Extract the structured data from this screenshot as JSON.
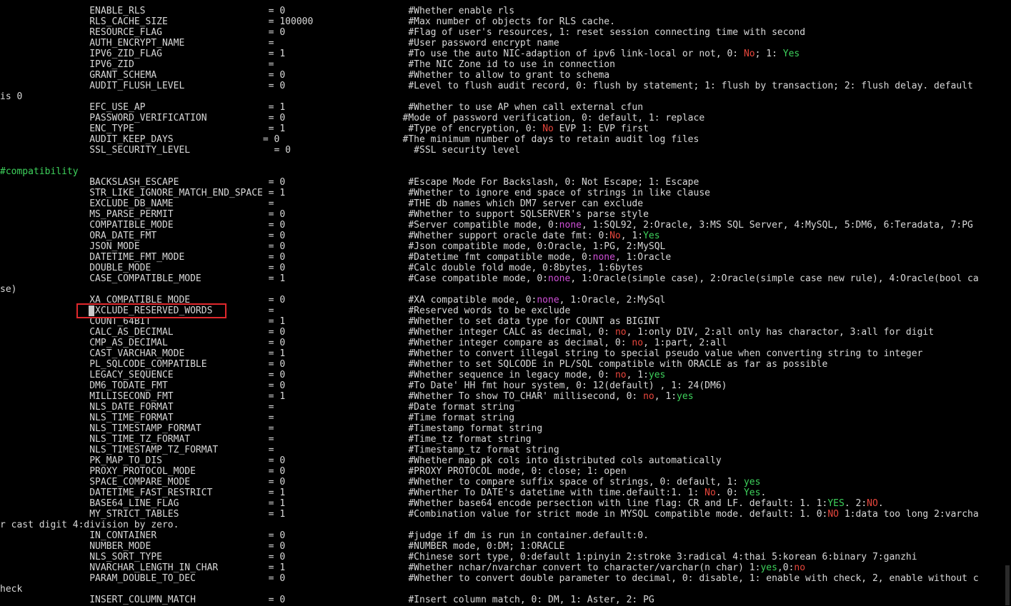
{
  "terminal": {
    "lines": [
      {
        "segs": [
          {
            "t": "                ENABLE_RLS                      = 0                      #Whether enable rls"
          }
        ]
      },
      {
        "segs": [
          {
            "t": "                RLS_CACHE_SIZE                  = 100000                 #Max number of objects for RLS cache."
          }
        ]
      },
      {
        "segs": [
          {
            "t": "                RESOURCE_FLAG                   = 0                      #Flag of user's resources, 1: reset session connecting time with second"
          }
        ]
      },
      {
        "segs": [
          {
            "t": "                AUTH_ENCRYPT_NAME               =                        #User password encrypt name"
          }
        ]
      },
      {
        "segs": [
          {
            "t": "                IPV6_ZID_FLAG                   = 1                      #To use the auto NIC-adaption of ipv6 link-local or not, 0: "
          },
          {
            "t": "No",
            "c": "c-red"
          },
          {
            "t": "; 1: "
          },
          {
            "t": "Yes",
            "c": "c-green"
          }
        ]
      },
      {
        "segs": [
          {
            "t": "                IPV6_ZID                        =                        #The NIC Zone id to use in connection"
          }
        ]
      },
      {
        "segs": [
          {
            "t": "                GRANT_SCHEMA                    = 0                      #Whether to allow to grant to schema"
          }
        ]
      },
      {
        "segs": [
          {
            "t": "                AUDIT_FLUSH_LEVEL               = 0                      #Level to flush audit record, 0: flush by statement; 1: flush by transaction; 2: flush delay. default"
          }
        ]
      },
      {
        "segs": [
          {
            "t": "is 0"
          }
        ]
      },
      {
        "segs": [
          {
            "t": "                EFC_USE_AP                      = 1                      #Whether to use AP when call external cfun"
          }
        ]
      },
      {
        "segs": [
          {
            "t": "                PASSWORD_VERIFICATION           = 0                     #Mode of password verification, 0: default, 1: replace"
          }
        ]
      },
      {
        "segs": [
          {
            "t": "                ENC_TYPE                        = 1                      #Type of encryption, 0: "
          },
          {
            "t": "No",
            "c": "c-red"
          },
          {
            "t": " EVP 1: EVP first"
          }
        ]
      },
      {
        "segs": [
          {
            "t": "                AUDIT_KEEP_DAYS                = 0                      #The minimum number of days to retain audit log files"
          }
        ]
      },
      {
        "segs": [
          {
            "t": "                SSL_SECURITY_LEVEL               = 0                      #SSL security level"
          }
        ]
      },
      {
        "segs": [
          {
            "t": ""
          }
        ]
      },
      {
        "segs": [
          {
            "t": "#compatibility",
            "c": "c-cyan"
          }
        ]
      },
      {
        "segs": [
          {
            "t": "                BACKSLASH_ESCAPE                = 0                      #Escape Mode For Backslash, 0: Not Escape; 1: Escape"
          }
        ]
      },
      {
        "segs": [
          {
            "t": "                STR_LIKE_IGNORE_MATCH_END_SPACE = 1                      #Whether to ignore end space of strings in like clause"
          }
        ]
      },
      {
        "segs": [
          {
            "t": "                EXCLUDE_DB_NAME                 =                        #THE db names which DM7 server can exclude"
          }
        ]
      },
      {
        "segs": [
          {
            "t": "                MS_PARSE_PERMIT                 = 0                      #Whether to support SQLSERVER's parse style"
          }
        ]
      },
      {
        "segs": [
          {
            "t": "                COMPATIBLE_MODE                 = 0                      #Server compatible mode, 0:"
          },
          {
            "t": "none",
            "c": "c-mag"
          },
          {
            "t": ", 1:SQL92, 2:Oracle, 3:MS SQL Server, 4:MySQL, 5:DM6, 6:Teradata, 7:PG"
          }
        ]
      },
      {
        "segs": [
          {
            "t": "                ORA_DATE_FMT                    = 0                      #Whether support oracle date fmt: 0:"
          },
          {
            "t": "No",
            "c": "c-red"
          },
          {
            "t": ", 1:"
          },
          {
            "t": "Yes",
            "c": "c-green"
          }
        ]
      },
      {
        "segs": [
          {
            "t": "                JSON_MODE                       = 0                      #Json compatible mode, 0:Oracle, 1:PG, 2:MySQL"
          }
        ]
      },
      {
        "segs": [
          {
            "t": "                DATETIME_FMT_MODE               = 0                      #Datetime fmt compatible mode, 0:"
          },
          {
            "t": "none",
            "c": "c-mag"
          },
          {
            "t": ", 1:Oracle"
          }
        ]
      },
      {
        "segs": [
          {
            "t": "                DOUBLE_MODE                     = 0                      #Calc double fold mode, 0:8bytes, 1:6bytes"
          }
        ]
      },
      {
        "segs": [
          {
            "t": "                CASE_COMPATIBLE_MODE            = 1                      #Case compatible mode, 0:"
          },
          {
            "t": "none",
            "c": "c-mag"
          },
          {
            "t": ", 1:Oracle(simple case), 2:Oracle(simple case new rule), 4:Oracle(bool ca"
          }
        ]
      },
      {
        "segs": [
          {
            "t": "se)"
          }
        ]
      },
      {
        "segs": [
          {
            "t": "                XA_COMPATIBLE_MODE              = 0                      #XA compatible mode, 0:"
          },
          {
            "t": "none",
            "c": "c-mag"
          },
          {
            "t": ", 1:Oracle, 2:MySql"
          }
        ]
      },
      {
        "segs": [
          {
            "t": "                EXCLUDE_RESERVED_WORDS          =                        #Reserved words to be exclude"
          }
        ]
      },
      {
        "segs": [
          {
            "t": "                COUNT_64BIT                     = 1                      #Whether to set data type for COUNT as BIGINT"
          }
        ]
      },
      {
        "segs": [
          {
            "t": "                CALC_AS_DECIMAL                 = 0                      #Whether integer CALC as decimal, 0: "
          },
          {
            "t": "no",
            "c": "c-red"
          },
          {
            "t": ", 1:only DIV, 2:all only has charactor, 3:all for digit"
          }
        ]
      },
      {
        "segs": [
          {
            "t": "                CMP_AS_DECIMAL                  = 0                      #Whether integer compare as decimal, 0: "
          },
          {
            "t": "no",
            "c": "c-red"
          },
          {
            "t": ", 1:part, 2:all"
          }
        ]
      },
      {
        "segs": [
          {
            "t": "                CAST_VARCHAR_MODE               = 1                      #Whether to convert illegal string to special pseudo value when converting string to integer"
          }
        ]
      },
      {
        "segs": [
          {
            "t": "                PL_SQLCODE_COMPATIBLE           = 0                      #Whether to set SQLCODE in PL/SQL compatible with ORACLE as far as possible"
          }
        ]
      },
      {
        "segs": [
          {
            "t": "                LEGACY_SEQUENCE                 = 0                      #Whether sequence in legacy mode, 0: "
          },
          {
            "t": "no",
            "c": "c-red"
          },
          {
            "t": ", 1:"
          },
          {
            "t": "yes",
            "c": "c-green"
          }
        ]
      },
      {
        "segs": [
          {
            "t": "                DM6_TODATE_FMT                  = 0                      #To Date' HH fmt hour system, 0: 12(default) , 1: 24(DM6)"
          }
        ]
      },
      {
        "segs": [
          {
            "t": "                MILLISECOND_FMT                 = 1                      #Whether To show TO_CHAR' millisecond, 0: "
          },
          {
            "t": "no",
            "c": "c-red"
          },
          {
            "t": ", 1:"
          },
          {
            "t": "yes",
            "c": "c-green"
          }
        ]
      },
      {
        "segs": [
          {
            "t": "                NLS_DATE_FORMAT                 =                        #Date format string"
          }
        ]
      },
      {
        "segs": [
          {
            "t": "                NLS_TIME_FORMAT                 =                        #Time format string"
          }
        ]
      },
      {
        "segs": [
          {
            "t": "                NLS_TIMESTAMP_FORMAT            =                        #Timestamp format string"
          }
        ]
      },
      {
        "segs": [
          {
            "t": "                NLS_TIME_TZ_FORMAT              =                        #Time_tz format string"
          }
        ]
      },
      {
        "segs": [
          {
            "t": "                NLS_TIMESTAMP_TZ_FORMAT         =                        #Timestamp_tz format string"
          }
        ]
      },
      {
        "segs": [
          {
            "t": "                PK_MAP_TO_DIS                   = 0                      #Whether map pk cols into distributed cols automatically"
          }
        ]
      },
      {
        "segs": [
          {
            "t": "                PROXY_PROTOCOL_MODE             = 0                      #PROXY PROTOCOL mode, 0: close; 1: open"
          }
        ]
      },
      {
        "segs": [
          {
            "t": "                SPACE_COMPARE_MODE              = 0                      #Whether to compare suffix space of strings, 0: default, 1: "
          },
          {
            "t": "yes",
            "c": "c-green"
          }
        ]
      },
      {
        "segs": [
          {
            "t": "                DATETIME_FAST_RESTRICT          = 1                      #Wherther To DATE's datetime with time.default:1. 1: "
          },
          {
            "t": "No",
            "c": "c-red"
          },
          {
            "t": ". 0: "
          },
          {
            "t": "Yes",
            "c": "c-green"
          },
          {
            "t": "."
          }
        ]
      },
      {
        "segs": [
          {
            "t": "                BASE64_LINE_FLAG                = 1                      #Whether base64 encode persection with line flag: CR and LF. default: 1. 1:"
          },
          {
            "t": "YES",
            "c": "c-green"
          },
          {
            "t": ". 2:"
          },
          {
            "t": "NO",
            "c": "c-red"
          },
          {
            "t": "."
          }
        ]
      },
      {
        "segs": [
          {
            "t": "                MY_STRICT_TABLES                = 1                      #Combination value for strict mode in MYSQL compatible mode. default: 1. 0:"
          },
          {
            "t": "NO",
            "c": "c-red"
          },
          {
            "t": " 1:data too long 2:varcha"
          }
        ]
      },
      {
        "segs": [
          {
            "t": "r cast digit 4:division by zero."
          }
        ]
      },
      {
        "segs": [
          {
            "t": "                IN_CONTAINER                    = 0                      #judge if dm is run in container.default:0."
          }
        ]
      },
      {
        "segs": [
          {
            "t": "                NUMBER_MODE                     = 0                      #NUMBER mode, 0:DM; 1:ORACLE"
          }
        ]
      },
      {
        "segs": [
          {
            "t": "                NLS_SORT_TYPE                   = 0                      #Chinese sort type, 0:default 1:pinyin 2:stroke 3:radical 4:thai 5:korean 6:binary 7:ganzhi"
          }
        ]
      },
      {
        "segs": [
          {
            "t": "                NVARCHAR_LENGTH_IN_CHAR         = 1                      #Whether nchar/nvarchar convert to character/varchar(n char) 1:"
          },
          {
            "t": "yes",
            "c": "c-green"
          },
          {
            "t": ",0:"
          },
          {
            "t": "no",
            "c": "c-red"
          }
        ]
      },
      {
        "segs": [
          {
            "t": "                PARAM_DOUBLE_TO_DEC             = 0                      #Whether to convert double parameter to decimal, 0: disable, 1: enable with check, 2, enable without c"
          }
        ]
      },
      {
        "segs": [
          {
            "t": "heck"
          }
        ]
      },
      {
        "segs": [
          {
            "t": "                INSERT_COLUMN_MATCH             = 0                      #Insert column match, 0: DM, 1: Aster, 2: PG"
          }
        ]
      }
    ]
  }
}
